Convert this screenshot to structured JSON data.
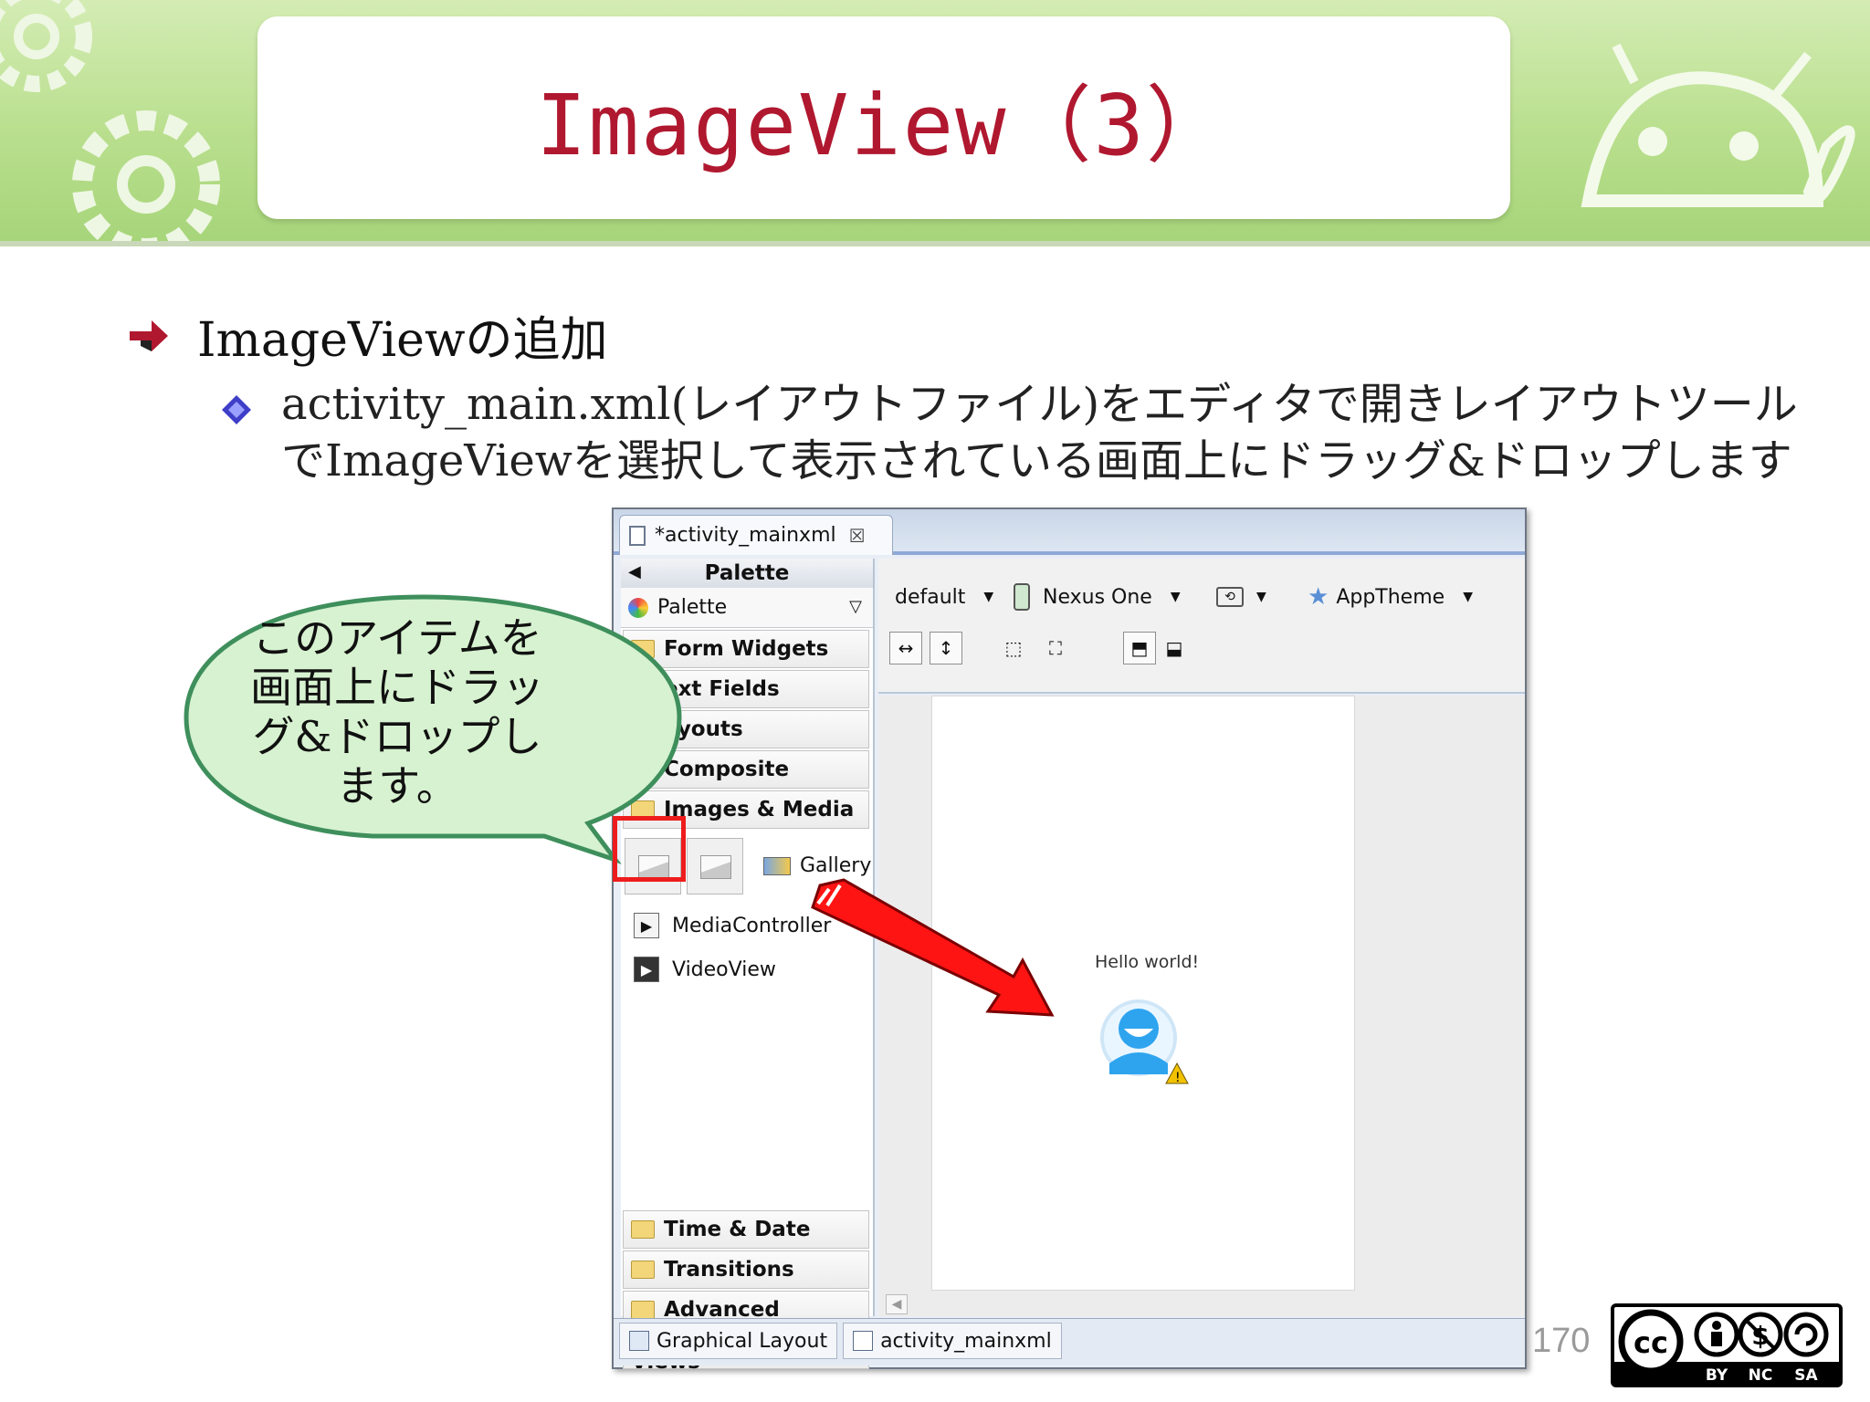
{
  "slide": {
    "title": "ImageView（3）",
    "bullet1": "ImageViewの追加",
    "bullet2": "activity_main.xml(レイアウトファイル)をエディタで開きレイアウトツールでImageViewを選択して表示されている画面上にドラッグ&ドロップします",
    "callout": "このアイテムを画面上にドラッグ&ドロップします。",
    "page_number": "170"
  },
  "editor": {
    "file_tab": "*activity_mainxml",
    "palette_header": "Palette",
    "palette_selector": "Palette",
    "categories_top": [
      "Form Widgets",
      "ext Fields",
      "ayouts",
      "Composite",
      "Images & Media"
    ],
    "media_items": [
      {
        "label": "Gallery"
      },
      {
        "label": "MediaController"
      },
      {
        "label": "VideoView"
      }
    ],
    "categories_bottom": [
      "Time & Date",
      "Transitions",
      "Advanced"
    ],
    "custom_views": "Custom &...ary Views",
    "toolbar": {
      "config": "default",
      "device": "Nexus One",
      "theme": "AppTheme"
    },
    "hello_text": "Hello world!",
    "bottom_tabs": [
      "Graphical Layout",
      "activity_mainxml"
    ]
  },
  "license": {
    "cc": "cc",
    "terms": [
      "BY",
      "NC",
      "SA"
    ]
  },
  "colors": {
    "title": "#b0182f",
    "banner_green": "#b9df8e",
    "callout_fill": "#d7f2d0",
    "callout_border": "#3e8f5c",
    "highlight_red": "#ee1c1c"
  }
}
